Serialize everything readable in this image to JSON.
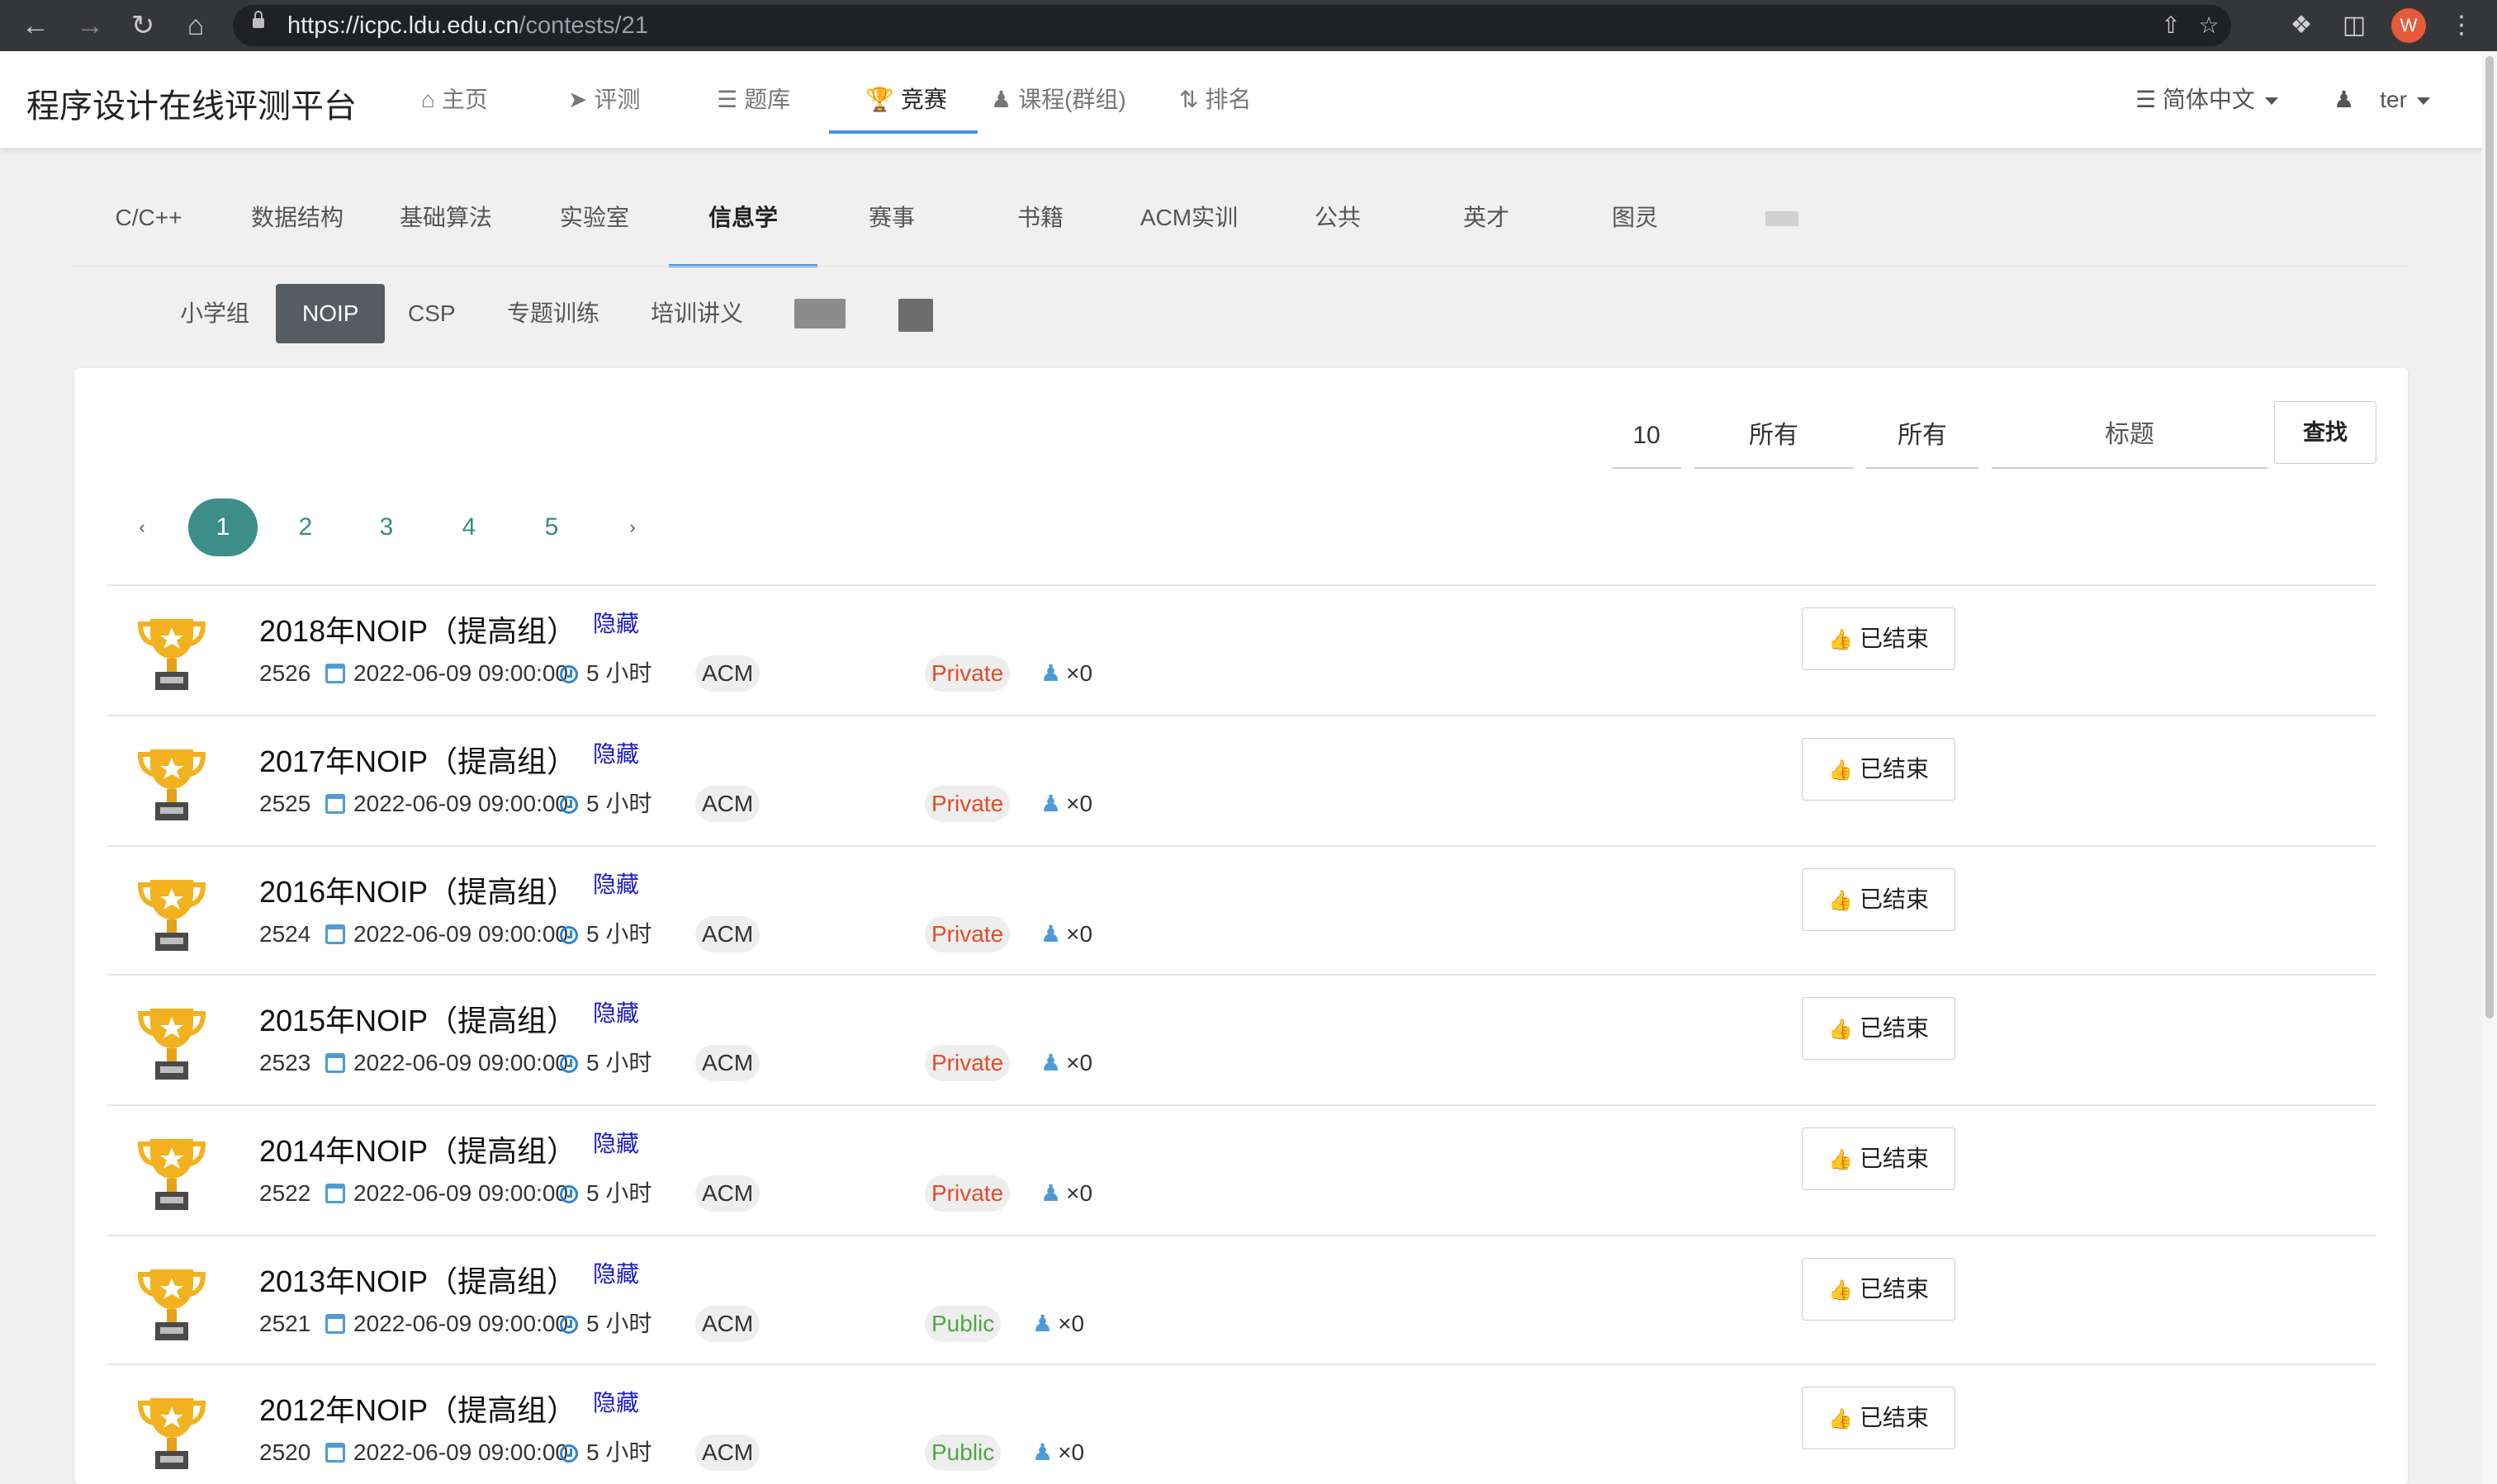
{
  "browser": {
    "url_host": "https://icpc.ldu.edu.cn",
    "url_path": "/contests/21",
    "profile_initial": "W"
  },
  "site": {
    "brand": "程序设计在线评测平台",
    "nav": [
      {
        "label": "主页",
        "icon": "home-icon"
      },
      {
        "label": "评测",
        "icon": "send-icon"
      },
      {
        "label": "题库",
        "icon": "list-icon"
      },
      {
        "label": "竞赛",
        "icon": "trophy-icon",
        "active": true
      },
      {
        "label": "课程(群组)",
        "icon": "users-icon"
      },
      {
        "label": "排名",
        "icon": "sort-icon"
      }
    ],
    "language": "简体中文",
    "user": "ter"
  },
  "categories": [
    "C/C++",
    "数据结构",
    "基础算法",
    "实验室",
    "信息学",
    "赛事",
    "书籍",
    "ACM实训",
    "公共",
    "英才",
    "图灵"
  ],
  "active_category": "信息学",
  "subcategories": [
    "小学组",
    "NOIP",
    "CSP",
    "专题训练",
    "培训讲义"
  ],
  "active_subcategory": "NOIP",
  "filters": {
    "page_size": "10",
    "type": "所有",
    "status": "所有",
    "title_placeholder": "标题",
    "search_label": "查找"
  },
  "pagination": {
    "prev": "‹",
    "pages": [
      "1",
      "2",
      "3",
      "4",
      "5"
    ],
    "current": "1",
    "next": "›"
  },
  "contests": [
    {
      "title": "2018年NOIP（提高组）",
      "hidden_label": "隐藏",
      "id": "2526",
      "start": "2022-06-09 09:00:00",
      "duration": "5 小时",
      "type": "ACM",
      "access": "Private",
      "participants": "×0",
      "status": "已结束"
    },
    {
      "title": "2017年NOIP（提高组）",
      "hidden_label": "隐藏",
      "id": "2525",
      "start": "2022-06-09 09:00:00",
      "duration": "5 小时",
      "type": "ACM",
      "access": "Private",
      "participants": "×0",
      "status": "已结束"
    },
    {
      "title": "2016年NOIP（提高组）",
      "hidden_label": "隐藏",
      "id": "2524",
      "start": "2022-06-09 09:00:00",
      "duration": "5 小时",
      "type": "ACM",
      "access": "Private",
      "participants": "×0",
      "status": "已结束"
    },
    {
      "title": "2015年NOIP（提高组）",
      "hidden_label": "隐藏",
      "id": "2523",
      "start": "2022-06-09 09:00:00",
      "duration": "5 小时",
      "type": "ACM",
      "access": "Private",
      "participants": "×0",
      "status": "已结束"
    },
    {
      "title": "2014年NOIP（提高组）",
      "hidden_label": "隐藏",
      "id": "2522",
      "start": "2022-06-09 09:00:00",
      "duration": "5 小时",
      "type": "ACM",
      "access": "Private",
      "participants": "×0",
      "status": "已结束"
    },
    {
      "title": "2013年NOIP（提高组）",
      "hidden_label": "隐藏",
      "id": "2521",
      "start": "2022-06-09 09:00:00",
      "duration": "5 小时",
      "type": "ACM",
      "access": "Public",
      "participants": "×0",
      "status": "已结束"
    },
    {
      "title": "2012年NOIP（提高组）",
      "hidden_label": "隐藏",
      "id": "2520",
      "start": "2022-06-09 09:00:00",
      "duration": "5 小时",
      "type": "ACM",
      "access": "Public",
      "participants": "×0",
      "status": "已结束"
    }
  ],
  "colors": {
    "accent_teal": "#3d8d89",
    "tab_underline": "#4a90e2",
    "private": "#e04f2a",
    "public": "#4caa3f",
    "hidden_link": "#1a1acc",
    "status_thumb": "#e53935",
    "trophy_gold": "#f2b11f"
  }
}
